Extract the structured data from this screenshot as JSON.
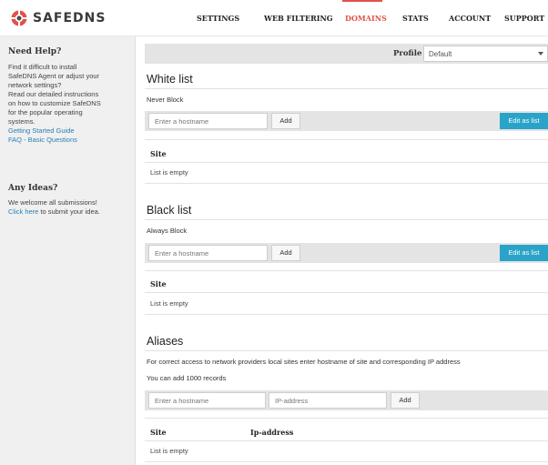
{
  "header": {
    "logo_text": "SAFEDNS",
    "nav": [
      {
        "label": "SETTINGS"
      },
      {
        "label": "WEB FILTERING"
      },
      {
        "label": "DOMAINS",
        "active": true
      },
      {
        "label": "STATS"
      },
      {
        "label": "ACCOUNT"
      },
      {
        "label": "SUPPORT"
      }
    ],
    "accent_color": "#e0524a"
  },
  "sidebar": {
    "help_title": "Need Help?",
    "help_lines": [
      "Find it difficult to install",
      "SafeDNS Agent or adjust your",
      "network settings?",
      "Read our detailed instructions",
      "on how to customize SafeDNS",
      "for the popular operating",
      "systems."
    ],
    "getting_started_link": "Getting Started Guide",
    "faq_link": "FAQ - Basic Questions",
    "ideas_title": "Any Ideas?",
    "ideas_line1": "We welcome all submissions!",
    "click_here_link": "Click here",
    "ideas_line2_rest": " to submit your idea."
  },
  "profile": {
    "label": "Profile",
    "selected": "Default"
  },
  "whitelist": {
    "title": "White list",
    "subtitle": "Never Block",
    "placeholder": "Enter a hostname",
    "add_label": "Add",
    "edit_label": "Edit as list",
    "col_site": "Site",
    "empty_text": "List is empty"
  },
  "blacklist": {
    "title": "Black list",
    "subtitle": "Always Block",
    "placeholder": "Enter a hostname",
    "add_label": "Add",
    "edit_label": "Edit as list",
    "col_site": "Site",
    "empty_text": "List is empty"
  },
  "aliases": {
    "title": "Aliases",
    "description": "For correct access to network providers local sites enter hostname of site and corresponding IP address",
    "limit_text": "You can add 1000 records",
    "host_placeholder": "Enter a hostname",
    "ip_placeholder": "IP-address",
    "add_label": "Add",
    "col_site": "Site",
    "col_ip": "Ip-address",
    "empty_text": "List is empty"
  },
  "colors": {
    "button_blue": "#2aa3c8",
    "link_blue": "#2a7fb5"
  }
}
